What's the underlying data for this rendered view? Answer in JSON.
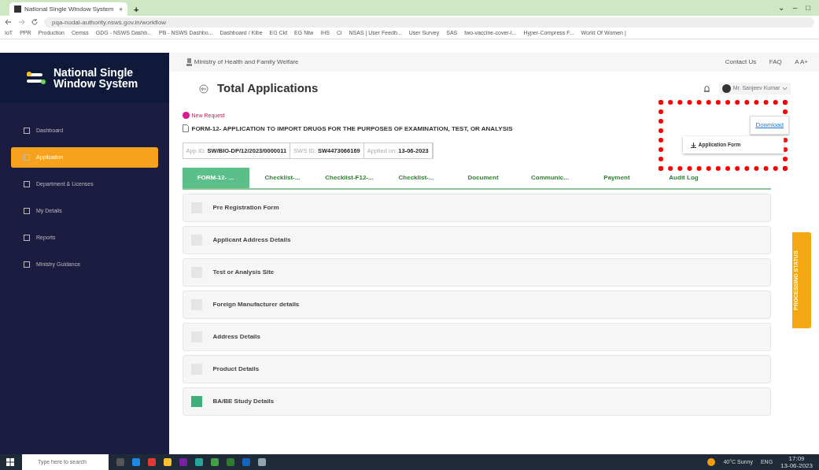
{
  "browser": {
    "tab_title": "National Single Window System",
    "tab_close": "×",
    "new_tab": "+",
    "url": "pqa-nodal-authority.nsws.gov.in/workflow",
    "window_controls": [
      "⌄",
      "–",
      "□"
    ],
    "bookmarks": [
      "IoT",
      "PPR",
      "Production",
      "Cemss",
      "GDG - NSWS Dashb...",
      "PB - NSWS Dashbo...",
      "Dashboard / Kibe",
      "EG Ckt",
      "EG Ntw",
      "IHS",
      "Ci",
      "NSAS | User Feedb...",
      "User Survey",
      "SAS",
      "two-vaccine-cover-l...",
      "Hyper-Compress F...",
      "World Of Women |"
    ]
  },
  "sidebar": {
    "logo_line1": "National Single",
    "logo_line2": "Window System",
    "items": [
      {
        "label": "Dashboard",
        "selected": false
      },
      {
        "label": "Application",
        "selected": true
      },
      {
        "label": "Department & Licenses",
        "selected": false
      },
      {
        "label": "My Details",
        "selected": false
      },
      {
        "label": "Reports",
        "selected": false
      },
      {
        "label": "Ministry Guidance",
        "selected": false
      }
    ]
  },
  "header": {
    "ministry": "Ministry of Health and Family Welfare",
    "links": [
      "Contact Us",
      "FAQ",
      "A A+"
    ]
  },
  "page": {
    "title": "Total Applications",
    "user": "Mr. Sanjeev Kumar",
    "badge": "New Request",
    "form_title": "FORM-12- APPLICATION TO IMPORT DRUGS FOR THE PURPOSES OF EXAMINATION, TEST, OR ANALYSIS",
    "ids": [
      {
        "label": "App ID:",
        "value": "SW/BIO-DP/12/2023/0000011"
      },
      {
        "label": "SWS ID:",
        "value": "SW4473066169"
      },
      {
        "label": "Applied on:",
        "value": "13-06-2023"
      }
    ],
    "download": {
      "label": "Download",
      "menu_item": "Application Form"
    },
    "tabs": [
      {
        "label": "FORM-12- ...",
        "selected": true
      },
      {
        "label": "Checklist-...",
        "selected": false
      },
      {
        "label": "Checklist-F12-...",
        "selected": false
      },
      {
        "label": "Checklist-...",
        "selected": false
      },
      {
        "label": "Document",
        "selected": false
      },
      {
        "label": "Communic...",
        "selected": false
      },
      {
        "label": "Payment",
        "selected": false
      },
      {
        "label": "Audit Log",
        "selected": false
      }
    ],
    "sections": [
      {
        "label": "Pre Registration Form",
        "active": false
      },
      {
        "label": "Applicant Address Details",
        "active": false
      },
      {
        "label": "Test or Analysis Site",
        "active": false
      },
      {
        "label": "Foreign Manufacturer details",
        "active": false
      },
      {
        "label": "Address Details",
        "active": false
      },
      {
        "label": "Product Details",
        "active": false
      },
      {
        "label": "BA/BE Study Details",
        "active": true
      }
    ],
    "side_tab": "PROCESSING STATUS"
  },
  "taskbar": {
    "search": "Type here to search",
    "weather": "40°C Sunny",
    "lang": "ENG",
    "time": "17:09",
    "date": "13-06-2023"
  }
}
